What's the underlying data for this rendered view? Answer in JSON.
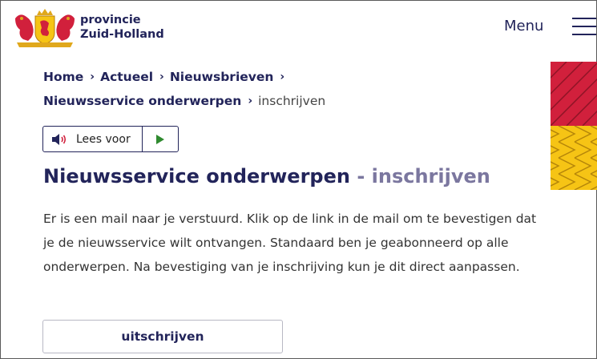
{
  "header": {
    "brand_line1": "provincie",
    "brand_line2": "Zuid-Holland",
    "menu_label": "Menu",
    "logo_icon": "coat-of-arms-icon",
    "hamburger_icon": "hamburger-menu-icon"
  },
  "breadcrumb": {
    "items": [
      "Home",
      "Actueel",
      "Nieuwsbrieven",
      "Nieuwsservice onderwerpen"
    ],
    "current": "inschrijven"
  },
  "readaloud": {
    "label": "Lees voor",
    "speaker_icon": "speaker-icon",
    "play_icon": "play-icon"
  },
  "main": {
    "title": "Nieuwsservice onderwerpen",
    "title_suffix": "- inschrijven",
    "paragraph": "Er is een mail naar je verstuurd. Klik op de link in de mail om te bevestigen dat je de nieuwsservice wilt ontvangen. Standaard ben je geabonneerd op alle onderwerpen. Na bevestiging van je inschrijving kun je dit direct aanpassen.",
    "unsubscribe_label": "uitschrijven"
  },
  "colors": {
    "brand_navy": "#22245a",
    "title_suffix": "#7b779f",
    "deco_red": "#d1203c",
    "deco_yellow": "#f6c415",
    "play_green": "#2f8a2f"
  }
}
